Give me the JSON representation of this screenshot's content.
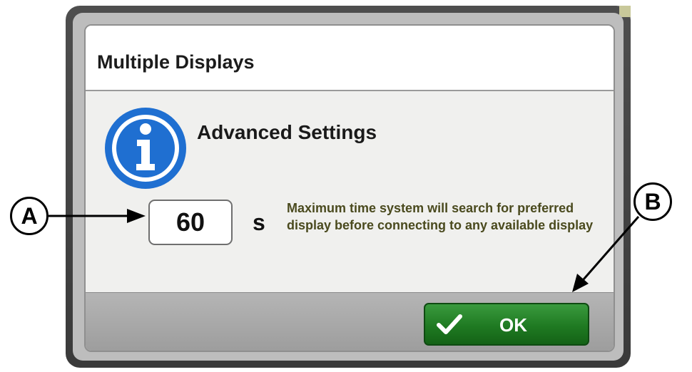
{
  "dialog": {
    "title": "Multiple Displays",
    "section_title": "Advanced Settings",
    "info_icon": "info-icon",
    "value": "60",
    "unit": "s",
    "description": "Maximum time system will search for preferred display before connecting to any available display",
    "ok_label": "OK",
    "ok_icon": "checkmark-icon"
  },
  "callouts": {
    "a": "A",
    "b": "B"
  },
  "colors": {
    "info_blue": "#1f6fd1",
    "ok_green": "#1f7a22",
    "frame_gray": "#454545"
  }
}
